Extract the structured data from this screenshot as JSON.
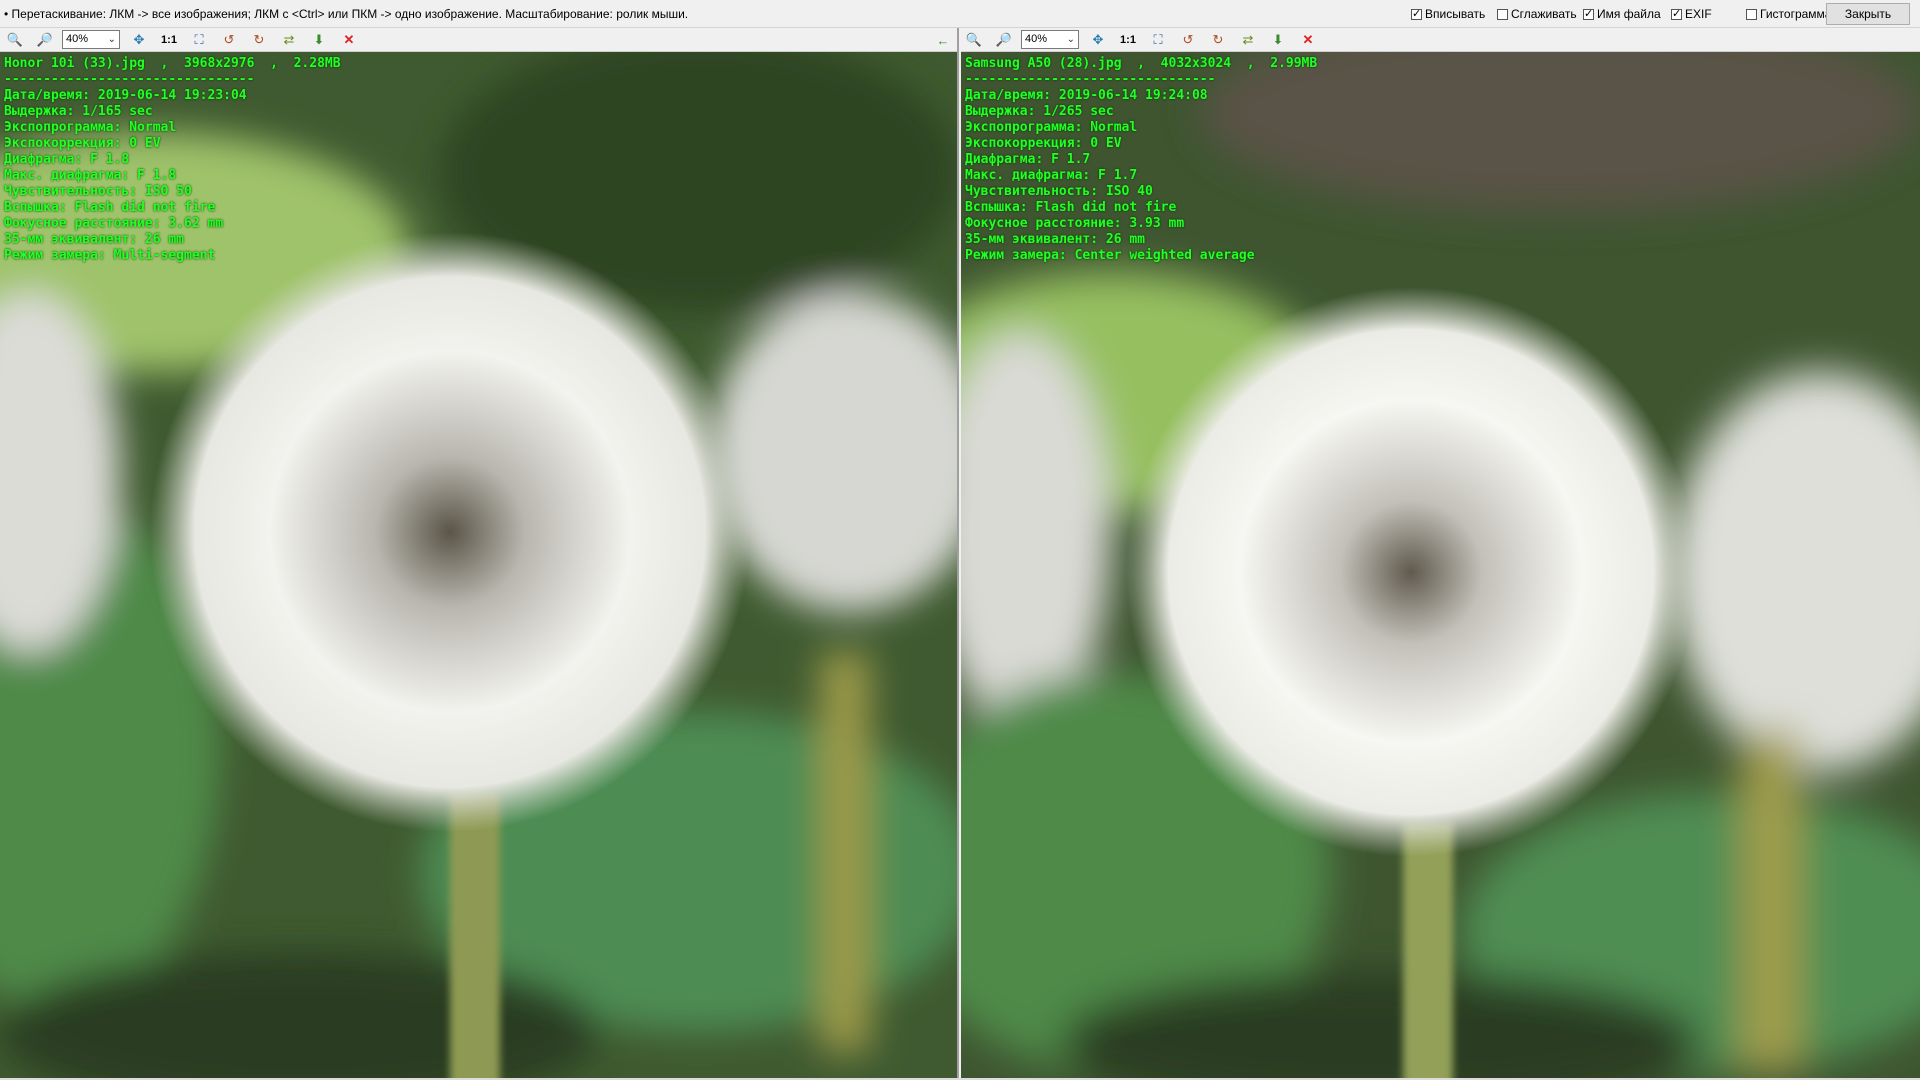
{
  "topbar": {
    "hint": "• Перетаскивание: ЛКМ -> все изображения; ЛКМ с <Ctrl> или ПКМ -> одно изображение. Масштабирование: ролик мыши.",
    "options": [
      {
        "label": "Вписывать",
        "checked": true
      },
      {
        "label": "Сглаживать",
        "checked": false
      },
      {
        "label": "Имя файла",
        "checked": true
      },
      {
        "label": "EXIF",
        "checked": true
      },
      {
        "label": "Гистограмма",
        "checked": false
      }
    ],
    "close_label": "Закрыть"
  },
  "panes": [
    {
      "zoom": "40%",
      "one_to_one": "1:1",
      "header": "Honor 10i (33).jpg  ,  3968x2976  ,  2.28MB",
      "separator": "--------------------------------",
      "exif": [
        "Дата/время: 2019-06-14 19:23:04",
        "Выдержка: 1/165 sec",
        "Экспопрограмма: Normal",
        "Экспокоррекция: 0 EV",
        "Диафрагма: F 1.8",
        "Макс. диафрагма: F 1.8",
        "Чувствительность: ISO 50",
        "Вспышка: Flash did not fire",
        "Фокусное расстояние: 3.62 mm",
        "35-мм эквивалент: 26 mm",
        "Режим замера: Multi-segment"
      ]
    },
    {
      "zoom": "40%",
      "one_to_one": "1:1",
      "header": "Samsung A50 (28).jpg  ,  4032x3024  ,  2.99MB",
      "separator": "--------------------------------",
      "exif": [
        "Дата/время: 2019-06-14 19:24:08",
        "Выдержка: 1/265 sec",
        "Экспопрограмма: Normal",
        "Экспокоррекция: 0 EV",
        "Диафрагма: F 1.7",
        "Макс. диафрагма: F 1.7",
        "Чувствительность: ISO 40",
        "Вспышка: Flash did not fire",
        "Фокусное расстояние: 3.93 mm",
        "35-мм эквивалент: 26 mm",
        "Режим замера: Center weighted average"
      ]
    }
  ],
  "icons": [
    "zoom-in-icon",
    "zoom-out-icon",
    "fit-icon",
    "one-to-one",
    "fullscreen-icon",
    "rotate-left-icon",
    "rotate-right-icon",
    "flip-icon",
    "save-icon",
    "close-pane-icon",
    "arrow-left-icon"
  ],
  "colors": {
    "exif_text": "#22ff22",
    "close_x": "#e02020"
  }
}
